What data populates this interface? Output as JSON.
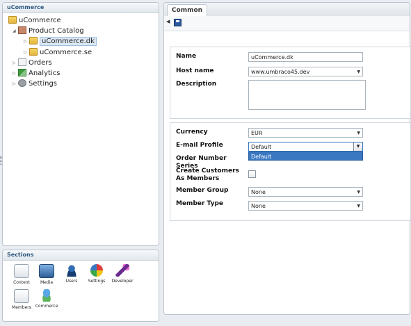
{
  "tree": {
    "panel_title": "uCommerce",
    "root_label": "uCommerce",
    "items": [
      {
        "label": "Product Catalog"
      },
      {
        "label": "uCommerce.dk"
      },
      {
        "label": "uCommerce.se"
      },
      {
        "label": "Orders"
      },
      {
        "label": "Analytics"
      },
      {
        "label": "Settings"
      }
    ]
  },
  "sections": {
    "title": "Sections",
    "items": [
      {
        "label": "Content",
        "icon": "content-icon"
      },
      {
        "label": "Media",
        "icon": "media-icon"
      },
      {
        "label": "Users",
        "icon": "users-icon"
      },
      {
        "label": "Settings",
        "icon": "settings-icon"
      },
      {
        "label": "Developer",
        "icon": "developer-icon"
      },
      {
        "label": "Members",
        "icon": "members-icon"
      },
      {
        "label": "Commerce",
        "icon": "commerce-icon"
      }
    ]
  },
  "content": {
    "tab_label": "Common",
    "form1": {
      "name_label": "Name",
      "name_value": "uCommerce.dk",
      "host_label": "Host name",
      "host_value": "www.umbraco45.dev",
      "description_label": "Description"
    },
    "form2": {
      "currency_label": "Currency",
      "currency_value": "EUR",
      "email_label": "E-mail Profile",
      "email_value": "Default",
      "email_option": "Default",
      "order_series_label": "Order Number Series",
      "create_customers_label": "Create Customers As Members",
      "member_group_label": "Member Group",
      "member_group_value": "None",
      "member_type_label": "Member Type",
      "member_type_value": "None"
    }
  },
  "colors": {
    "selection_blue": "#3a78c2",
    "panel_border": "#bcc5cf"
  }
}
